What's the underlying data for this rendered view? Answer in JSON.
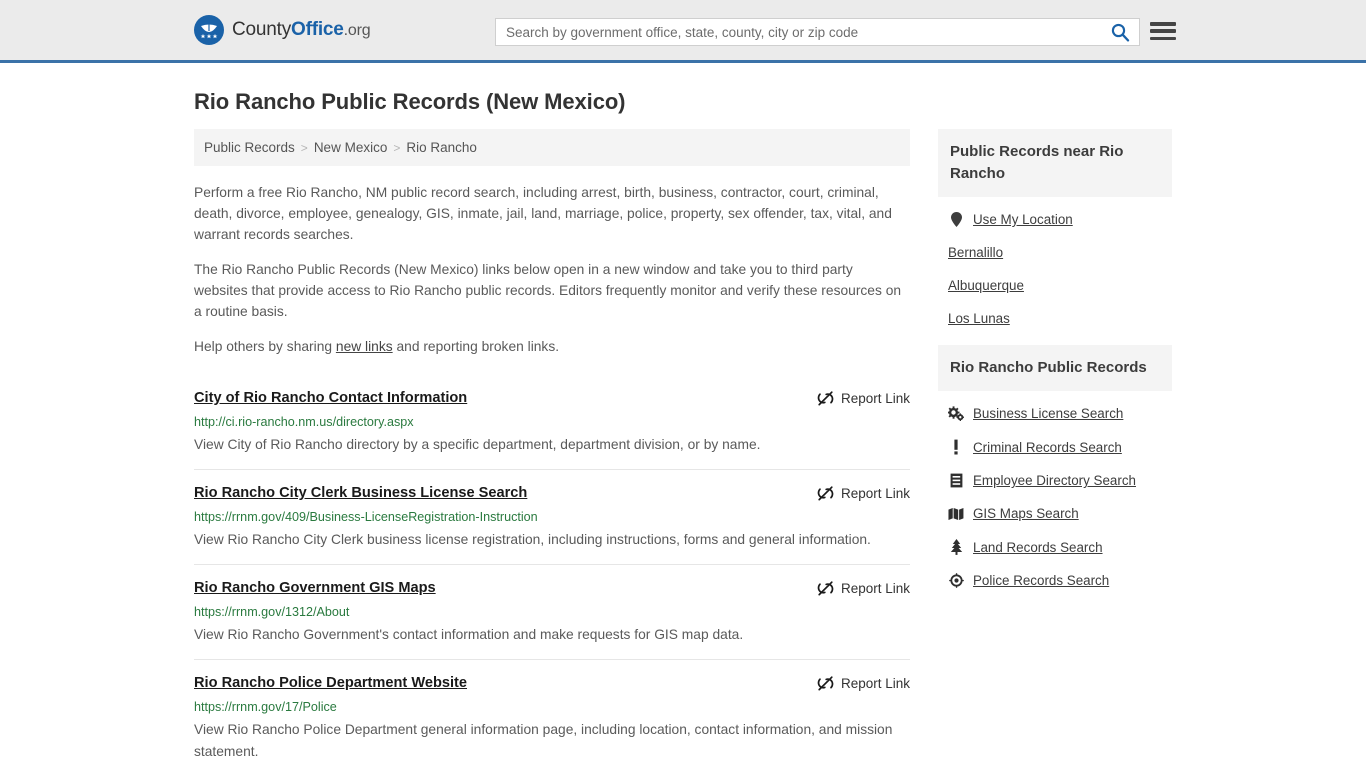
{
  "header": {
    "brand": {
      "part1": "County",
      "part2": "Office",
      "part3": ".org"
    },
    "search": {
      "placeholder": "Search by government office, state, county, city or zip code",
      "value": "",
      "icon": "search-icon"
    },
    "menu_icon": "hamburger-menu-icon",
    "accent_color": "#3b72a8",
    "background_color": "#ebebeb"
  },
  "page": {
    "title": "Rio Rancho Public Records (New Mexico)"
  },
  "breadcrumb": {
    "items": [
      {
        "label": "Public Records"
      },
      {
        "label": "New Mexico"
      },
      {
        "label": "Rio Rancho"
      }
    ],
    "separator": ">"
  },
  "intro": {
    "paragraph1": "Perform a free Rio Rancho, NM public record search, including arrest, birth, business, contractor, court, criminal, death, divorce, employee, genealogy, GIS, inmate, jail, land, marriage, police, property, sex offender, tax, vital, and warrant records searches.",
    "paragraph2": "The Rio Rancho Public Records (New Mexico) links below open in a new window and take you to third party websites that provide access to Rio Rancho public records. Editors frequently monitor and verify these resources on a routine basis.",
    "help_prefix": "Help others by sharing ",
    "help_link": "new links",
    "help_suffix": " and reporting broken links."
  },
  "results": {
    "report_label": "Report Link",
    "report_icon": "broken-link-icon",
    "items": [
      {
        "title": "City of Rio Rancho Contact Information",
        "url": "http://ci.rio-rancho.nm.us/directory.aspx",
        "description": "View City of Rio Rancho directory by a specific department, department division, or by name."
      },
      {
        "title": "Rio Rancho City Clerk Business License Search",
        "url": "https://rrnm.gov/409/Business-LicenseRegistration-Instruction",
        "description": "View Rio Rancho City Clerk business license registration, including instructions, forms and general information."
      },
      {
        "title": "Rio Rancho Government GIS Maps",
        "url": "https://rrnm.gov/1312/About",
        "description": "View Rio Rancho Government's contact information and make requests for GIS map data."
      },
      {
        "title": "Rio Rancho Police Department Website",
        "url": "https://rrnm.gov/17/Police",
        "description": "View Rio Rancho Police Department general information page, including location, contact information, and mission statement."
      }
    ]
  },
  "sidebar": {
    "nearby": {
      "heading": "Public Records near Rio Rancho",
      "items": [
        {
          "label": "Use My Location",
          "icon": "map-pin-icon"
        },
        {
          "label": "Bernalillo",
          "icon": ""
        },
        {
          "label": "Albuquerque",
          "icon": ""
        },
        {
          "label": "Los Lunas",
          "icon": ""
        }
      ]
    },
    "records": {
      "heading": "Rio Rancho Public Records",
      "items": [
        {
          "label": "Business License Search",
          "icon": "cogs-icon"
        },
        {
          "label": "Criminal Records Search",
          "icon": "exclamation-icon"
        },
        {
          "label": "Employee Directory Search",
          "icon": "list-book-icon"
        },
        {
          "label": "GIS Maps Search",
          "icon": "map-icon"
        },
        {
          "label": "Land Records Search",
          "icon": "tree-icon"
        },
        {
          "label": "Police Records Search",
          "icon": "police-badge-icon"
        }
      ]
    }
  },
  "colors": {
    "link_green": "#2a7a3f",
    "brand_blue": "#1a62a8",
    "panel_gray": "#f4f4f4"
  }
}
